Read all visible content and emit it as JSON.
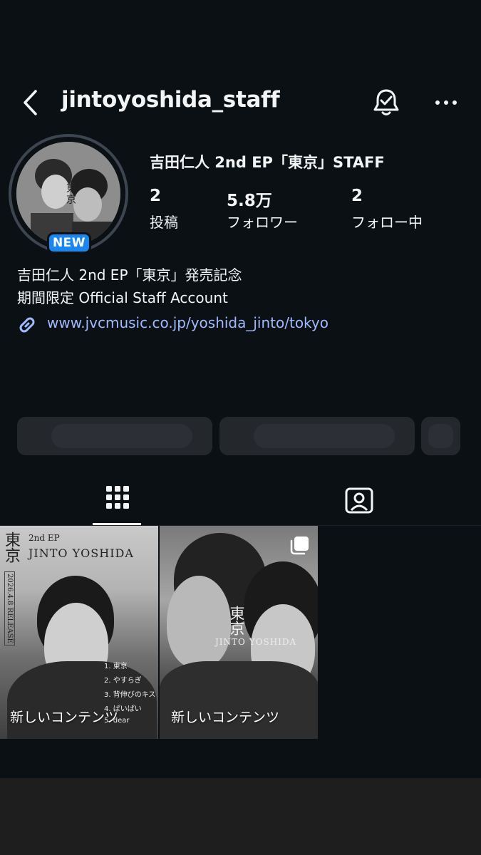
{
  "header": {
    "username": "jintoyoshida_staff",
    "back_icon": "chevron-left-icon",
    "bell_icon": "bell-check-icon",
    "more_icon": "more-horizontal-icon"
  },
  "profile": {
    "display_name": "吉田仁人 2nd EP「東京」STAFF",
    "new_badge": "NEW",
    "stats": [
      {
        "value": "2",
        "label": "投稿"
      },
      {
        "value": "5.8万",
        "label": "フォロワー"
      },
      {
        "value": "2",
        "label": "フォロー中"
      }
    ],
    "bio": [
      "吉田仁人 2nd EP「東京」発売記念",
      "期間限定 Official Staff Account"
    ],
    "link": "www.jvcmusic.co.jp/yoshida_jinto/tokyo"
  },
  "tabs": [
    {
      "icon": "grid-icon",
      "active": true
    },
    {
      "icon": "tagged-person-icon",
      "active": false
    }
  ],
  "posts": [
    {
      "caption": "新しいコンテンツ",
      "title": "東京",
      "ep": "2nd EP",
      "artist": "JINTO YOSHIDA",
      "date": "2026.4.8 RELEASE",
      "tracks": [
        "1. 東京",
        "2. やすらぎ",
        "3. 背伸びのキス",
        "4. ぱいぱい",
        "5. dear"
      ]
    },
    {
      "caption": "新しいコンテンツ",
      "title": "東京",
      "artist": "JINTO YOSHIDA",
      "multi_icon": "carousel-icon"
    }
  ],
  "colors": {
    "background": "#0b1014",
    "link": "#a0baff",
    "badge": "#1a86f0"
  }
}
